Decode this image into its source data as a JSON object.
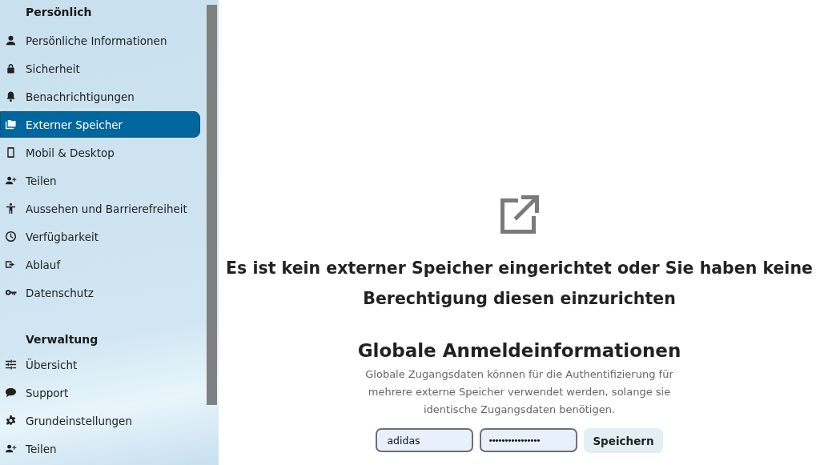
{
  "sidebar": {
    "sections": [
      {
        "title": "Persönlich",
        "items": [
          {
            "label": "Persönliche Informationen",
            "selected": false
          },
          {
            "label": "Sicherheit",
            "selected": false
          },
          {
            "label": "Benachrichtigungen",
            "selected": false
          },
          {
            "label": "Externer Speicher",
            "selected": true
          },
          {
            "label": "Mobil & Desktop",
            "selected": false
          },
          {
            "label": "Teilen",
            "selected": false
          },
          {
            "label": "Aussehen und Barrierefreiheit",
            "selected": false
          },
          {
            "label": "Verfügbarkeit",
            "selected": false
          },
          {
            "label": "Ablauf",
            "selected": false
          },
          {
            "label": "Datenschutz",
            "selected": false
          }
        ]
      },
      {
        "title": "Verwaltung",
        "items": [
          {
            "label": "Übersicht",
            "selected": false
          },
          {
            "label": "Support",
            "selected": false
          },
          {
            "label": "Grundeinstellungen",
            "selected": false
          },
          {
            "label": "Teilen",
            "selected": false
          }
        ]
      }
    ]
  },
  "empty_state": {
    "message": "Es ist kein externer Speicher eingerichtet oder Sie haben keine Berechtigung diesen einzurichten"
  },
  "global_credentials": {
    "title": "Globale Anmeldeinformationen",
    "description": "Globale Zugangsdaten können für die Authentifizierung für mehrere externe Speicher verwendet werden, solange sie identische Zugangsdaten benötigen.",
    "username": "adidas",
    "password": "••••••••••••••••",
    "save_button": "Speichern"
  }
}
